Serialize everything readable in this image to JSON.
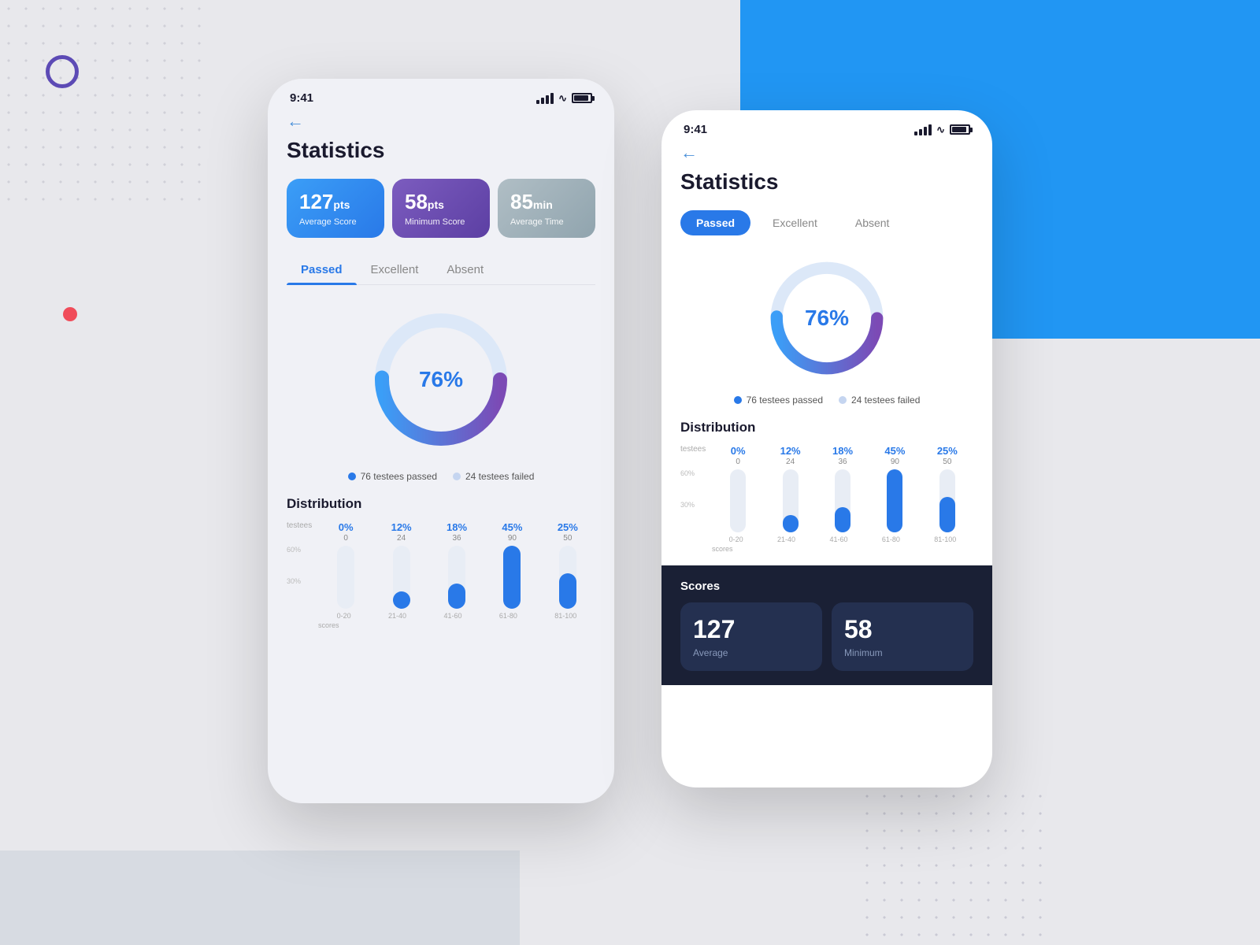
{
  "background": {
    "blue_rect_color": "#2196f3"
  },
  "phone1": {
    "status_bar": {
      "time": "9:41"
    },
    "back_arrow": "←",
    "title": "Statistics",
    "score_cards": [
      {
        "value": "127",
        "unit": "pts",
        "label": "Average Score",
        "type": "blue"
      },
      {
        "value": "58",
        "unit": "pts",
        "label": "Minimum Score",
        "type": "purple"
      },
      {
        "value": "85",
        "unit": "min",
        "label": "Average Time",
        "type": "gray"
      }
    ],
    "tabs": [
      {
        "label": "Passed",
        "active": true
      },
      {
        "label": "Excellent",
        "active": false
      },
      {
        "label": "Absent",
        "active": false
      }
    ],
    "donut": {
      "percentage": "76%",
      "passed_value": 76,
      "failed_value": 24
    },
    "legend": [
      {
        "label": "76 testees passed",
        "color": "#2979e8"
      },
      {
        "label": "24 testees failed",
        "color": "#c5d5f0"
      }
    ],
    "distribution": {
      "title": "Distribution",
      "columns": [
        {
          "pct": "0%",
          "sub": "0",
          "range": "0-20"
        },
        {
          "pct": "12%",
          "sub": "24",
          "range": "21-40"
        },
        {
          "pct": "18%",
          "sub": "36",
          "range": "41-60"
        },
        {
          "pct": "45%",
          "sub": "90",
          "range": "61-80"
        },
        {
          "pct": "25%",
          "sub": "50",
          "range": "81-100"
        }
      ],
      "row_label": "testees",
      "y_labels": [
        "60%",
        "30%"
      ],
      "x_label": "scores"
    }
  },
  "phone2": {
    "status_bar": {
      "time": "9:41"
    },
    "back_arrow": "←",
    "title": "Statistics",
    "tabs": [
      {
        "label": "Passed",
        "active": true
      },
      {
        "label": "Excellent",
        "active": false
      },
      {
        "label": "Absent",
        "active": false
      }
    ],
    "donut": {
      "percentage": "76%",
      "passed_value": 76,
      "failed_value": 24
    },
    "legend": [
      {
        "label": "76 testees passed",
        "color": "#2979e8"
      },
      {
        "label": "24 testees failed",
        "color": "#c5d5f0"
      }
    ],
    "distribution": {
      "title": "Distribution",
      "columns": [
        {
          "pct": "0%",
          "sub": "0",
          "range": "0-20"
        },
        {
          "pct": "12%",
          "sub": "24",
          "range": "21-40"
        },
        {
          "pct": "18%",
          "sub": "36",
          "range": "41-60"
        },
        {
          "pct": "45%",
          "sub": "90",
          "range": "61-80"
        },
        {
          "pct": "25%",
          "sub": "50",
          "range": "81-100"
        }
      ],
      "row_label": "testees",
      "y_labels": [
        "60%",
        "30%"
      ],
      "x_label": "scores"
    },
    "scores_section": {
      "title": "Scores",
      "cards": [
        {
          "value": "127",
          "label": "Average"
        },
        {
          "value": "58",
          "label": "Minimum"
        }
      ]
    }
  }
}
